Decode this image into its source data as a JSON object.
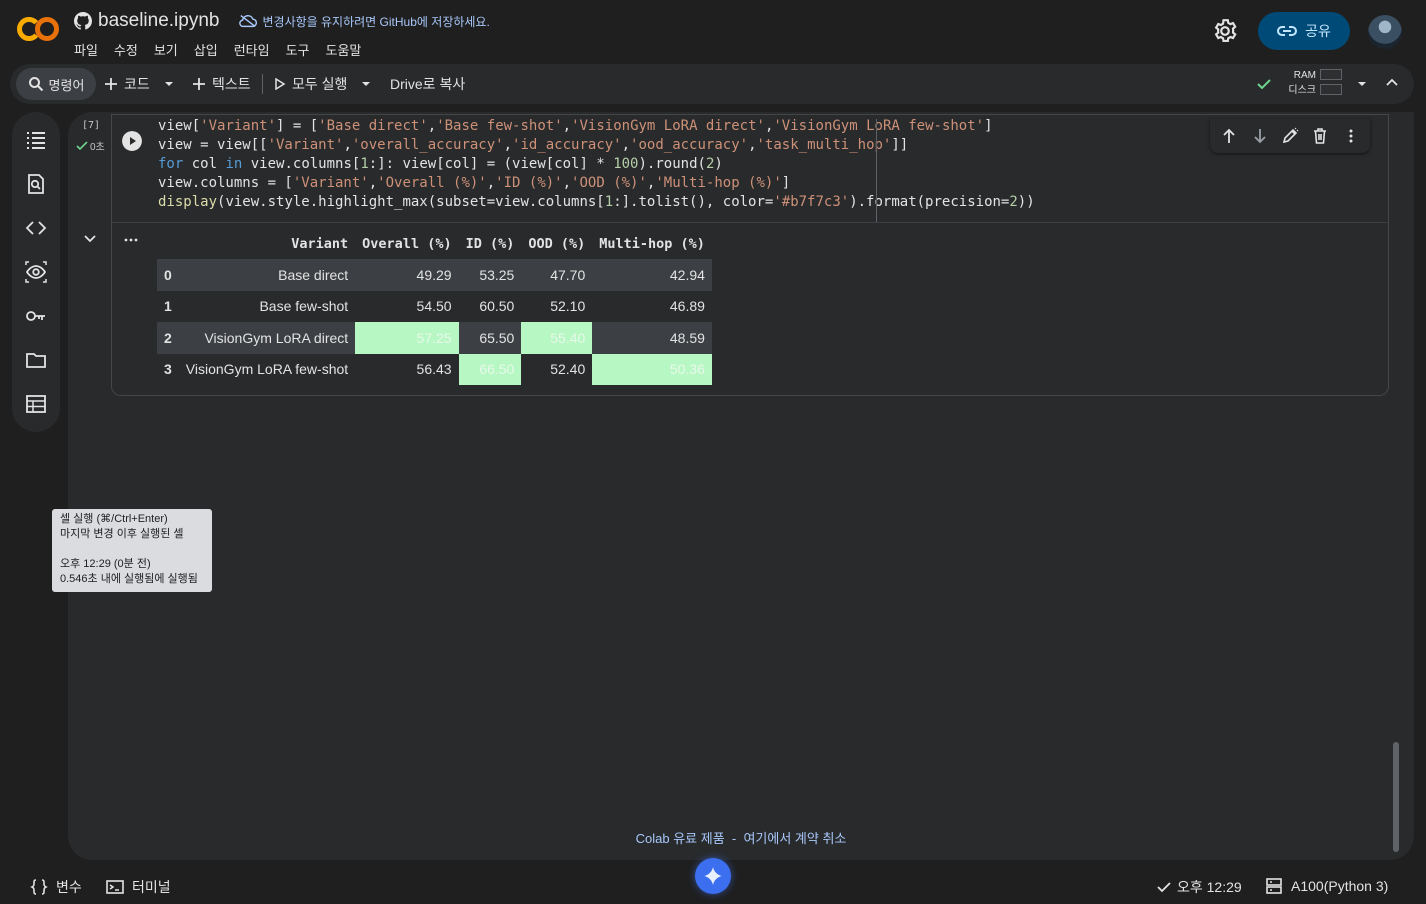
{
  "header": {
    "notebook_title": "baseline.ipynb",
    "save_notice": "변경사항을 유지하려면 GitHub에 저장하세요.",
    "menu": [
      "파일",
      "수정",
      "보기",
      "삽입",
      "런타임",
      "도구",
      "도움말"
    ],
    "share_label": "공유"
  },
  "toolbar": {
    "command_label": "명령어",
    "code_label": "코드",
    "text_label": "텍스트",
    "run_all_label": "모두 실행",
    "copy_drive_label": "Drive로 복사",
    "ram_label": "RAM",
    "disk_label": "디스크"
  },
  "cell": {
    "exec_count": "[7]",
    "exec_time": "0초",
    "code_lines": [
      "view['Variant'] = ['Base direct','Base few-shot','VisionGym LoRA direct','VisionGym LoRA few-shot']",
      "view = view[['Variant','overall_accuracy','id_accuracy','ood_accuracy','task_multi_hop']]",
      "for col in view.columns[1:]: view[col] = (view[col] * 100).round(2)",
      "view.columns = ['Variant','Overall (%)','ID (%)','OOD (%)','Multi-hop (%)']",
      "display(view.style.highlight_max(subset=view.columns[1:].tolist(), color='#b7f7c3').format(precision=2))"
    ]
  },
  "output_table": {
    "columns": [
      "",
      "Variant",
      "Overall (%)",
      "ID (%)",
      "OOD (%)",
      "Multi-hop (%)"
    ],
    "rows": [
      [
        "0",
        "Base direct",
        "49.29",
        "53.25",
        "47.70",
        "42.94"
      ],
      [
        "1",
        "Base few-shot",
        "54.50",
        "60.50",
        "52.10",
        "46.89"
      ],
      [
        "2",
        "VisionGym LoRA direct",
        "57.25",
        "65.50",
        "55.40",
        "48.59"
      ],
      [
        "3",
        "VisionGym LoRA few-shot",
        "56.43",
        "66.50",
        "52.40",
        "50.36"
      ]
    ],
    "highlight_color": "#b7f7c3"
  },
  "tooltip": {
    "line1": "셀 실행 (⌘/Ctrl+Enter)",
    "line2": "마지막 변경 이후 실행된 셀",
    "line3": "오후 12:29 (0분 전)",
    "line4": "0.546초 내에 실행됨에 실행됨"
  },
  "footer_links": {
    "paid": "Colab 유료 제품",
    "separator": "-",
    "cancel": "여기에서 계약 취소"
  },
  "statusbar": {
    "variables_label": "변수",
    "terminal_label": "터미널",
    "time_label": "오후 12:29",
    "runtime_label": "A100(Python 3)"
  },
  "colors": {
    "accent": "#a8c7fa",
    "share_bg": "#004a77",
    "check": "#6dd58c"
  }
}
